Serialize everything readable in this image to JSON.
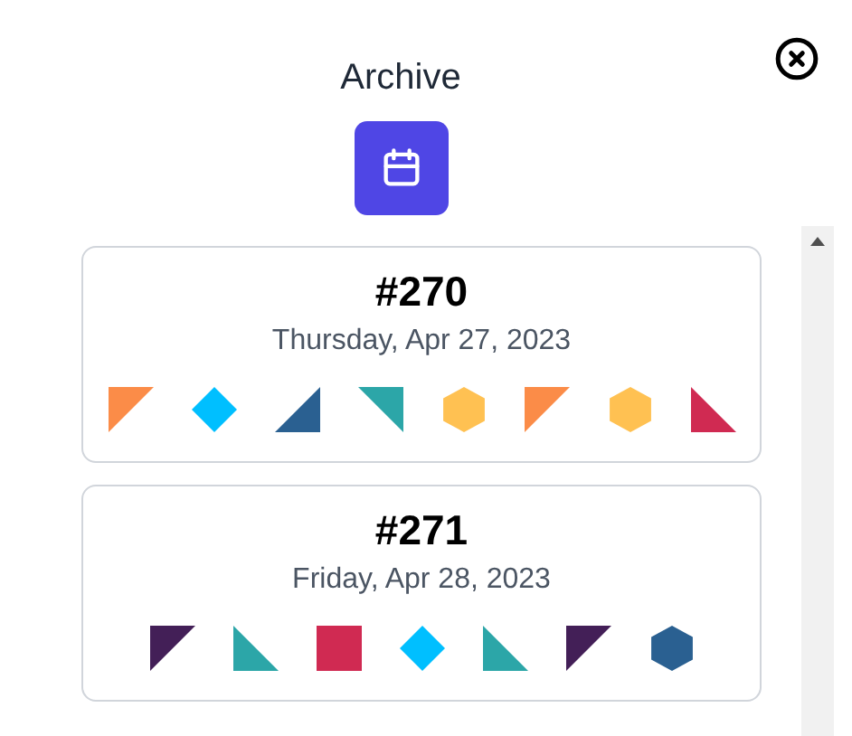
{
  "title": "Archive",
  "entries": [
    {
      "number": "#270",
      "date": "Thursday, Apr 27, 2023",
      "shapes": [
        {
          "kind": "tri-tl",
          "color": "#fb8c48"
        },
        {
          "kind": "diamond",
          "color": "#00bfff"
        },
        {
          "kind": "tri-br",
          "color": "#2a6091"
        },
        {
          "kind": "tri-tr",
          "color": "#2ca6a8"
        },
        {
          "kind": "hexagon",
          "color": "#ffc152"
        },
        {
          "kind": "tri-tl",
          "color": "#fb8c48"
        },
        {
          "kind": "hexagon",
          "color": "#ffc152"
        },
        {
          "kind": "tri-bl",
          "color": "#d02a52"
        }
      ]
    },
    {
      "number": "#271",
      "date": "Friday, Apr 28, 2023",
      "shapes": [
        {
          "kind": "tri-tl",
          "color": "#431f57"
        },
        {
          "kind": "tri-bl",
          "color": "#2ca6a8"
        },
        {
          "kind": "square",
          "color": "#d02a52"
        },
        {
          "kind": "diamond",
          "color": "#00bfff"
        },
        {
          "kind": "tri-bl",
          "color": "#2ca6a8"
        },
        {
          "kind": "tri-tl",
          "color": "#431f57"
        },
        {
          "kind": "hexagon",
          "color": "#2a6091"
        }
      ]
    }
  ]
}
